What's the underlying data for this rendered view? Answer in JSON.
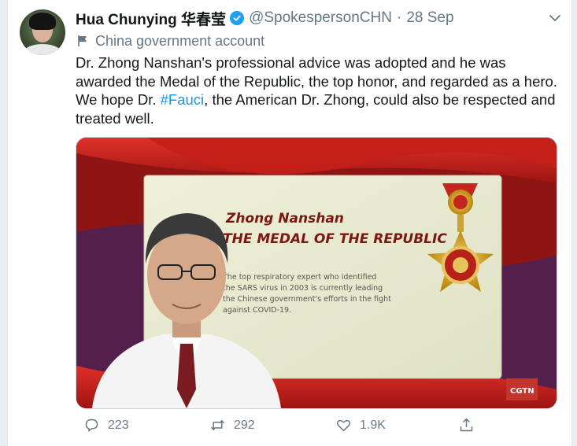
{
  "tweet": {
    "author_name": "Hua Chunying 华春莹",
    "handle": "@SpokespersonCHN",
    "separator": "·",
    "date": "28 Sep",
    "account_label": "China government account",
    "text_before_hashtag": "Dr. Zhong Nanshan's professional advice was adopted and he was awarded the Medal of the Republic, the top honor, and regarded as a hero. We hope Dr. ",
    "hashtag": "#Fauci",
    "text_after_hashtag": ", the American Dr. Zhong, could also be respected and treated well."
  },
  "media": {
    "card_name": "Zhong Nanshan",
    "card_title": "THE MEDAL OF THE REPUBLIC",
    "card_description_lines": [
      "The top respiratory expert who identified",
      "the SARS virus in 2003 is currently leading",
      "the Chinese government's efforts in the fight",
      "against COVID-19."
    ],
    "watermark": "CGTN"
  },
  "actions": {
    "replies": "223",
    "retweets": "292",
    "likes": "1.9K"
  },
  "icons": [
    "verified-badge-icon",
    "chevron-down-icon",
    "flag-icon",
    "reply-icon",
    "retweet-icon",
    "like-icon",
    "share-icon"
  ],
  "colors": {
    "accent": "#1da1f2",
    "hashtag": "#1b95e0",
    "secondary_text": "#657786"
  }
}
